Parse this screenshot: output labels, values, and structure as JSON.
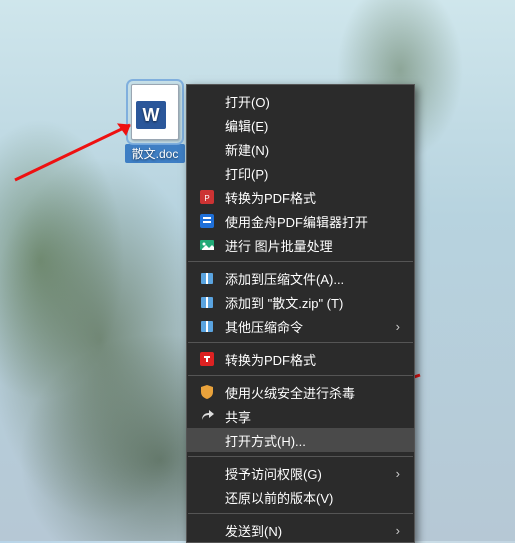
{
  "desktop": {
    "file_label": "散文.doc",
    "file_app_letter": "W",
    "file_icon_name": "word-document-icon"
  },
  "menu": {
    "items": [
      {
        "icon": "",
        "label": "打开(O)",
        "submenu": false
      },
      {
        "icon": "",
        "label": "编辑(E)",
        "submenu": false
      },
      {
        "icon": "",
        "label": "新建(N)",
        "submenu": false
      },
      {
        "icon": "",
        "label": "打印(P)",
        "submenu": false
      },
      {
        "icon": "pdf",
        "label": "转换为PDF格式",
        "submenu": false
      },
      {
        "icon": "pdf-editor",
        "label": "使用金舟PDF编辑器打开",
        "submenu": false
      },
      {
        "icon": "image-batch",
        "label": "进行 图片批量处理",
        "submenu": false
      },
      {
        "icon": "archive",
        "label": "添加到压缩文件(A)...",
        "submenu": false
      },
      {
        "icon": "archive",
        "label": "添加到 \"散文.zip\" (T)",
        "submenu": false
      },
      {
        "icon": "archive",
        "label": "其他压缩命令",
        "submenu": true
      },
      {
        "icon": "pdf-red",
        "label": "转换为PDF格式",
        "submenu": false
      },
      {
        "icon": "shield",
        "label": "使用火绒安全进行杀毒",
        "submenu": false
      },
      {
        "icon": "share",
        "label": "共享",
        "submenu": false
      },
      {
        "icon": "",
        "label": "打开方式(H)...",
        "submenu": false,
        "highlight": true
      },
      {
        "icon": "",
        "label": "授予访问权限(G)",
        "submenu": true
      },
      {
        "icon": "",
        "label": "还原以前的版本(V)",
        "submenu": false
      },
      {
        "icon": "",
        "label": "发送到(N)",
        "submenu": true
      }
    ],
    "separators_after": [
      6,
      9,
      10,
      13,
      15
    ]
  }
}
